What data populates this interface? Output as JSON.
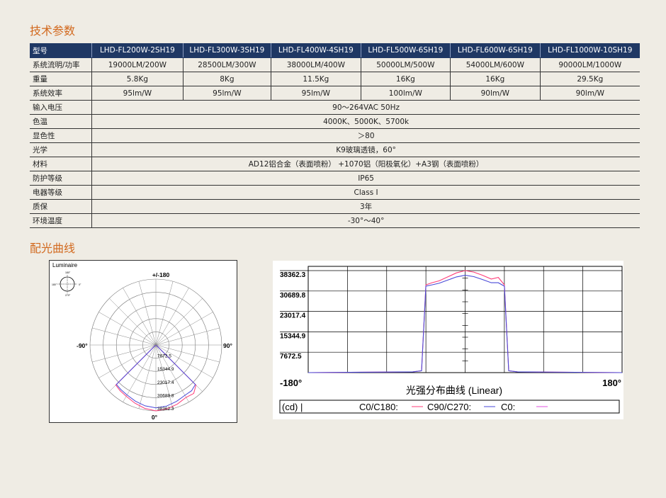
{
  "sections": {
    "spec_title": "技术参数",
    "curve_title": "配光曲线"
  },
  "spec_table": {
    "header": [
      "型号",
      "LHD-FL200W-2SH19",
      "LHD-FL300W-3SH19",
      "LHD-FL400W-4SH19",
      "LHD-FL500W-6SH19",
      "LHD-FL600W-6SH19",
      "LHD-FL1000W-10SH19"
    ],
    "rows": [
      {
        "label": "系统流明/功率",
        "cells": [
          "19000LM/200W",
          "28500LM/300W",
          "38000LM/400W",
          "50000LM/500W",
          "54000LM/600W",
          "90000LM/1000W"
        ]
      },
      {
        "label": "重量",
        "cells": [
          "5.8Kg",
          "8Kg",
          "11.5Kg",
          "16Kg",
          "16Kg",
          "29.5Kg"
        ]
      },
      {
        "label": "系统效率",
        "cells": [
          "95lm/W",
          "95lm/W",
          "95lm/W",
          "100lm/W",
          "90lm/W",
          "90lm/W"
        ]
      },
      {
        "label": "输入电压",
        "span": "90～264VAC   50Hz"
      },
      {
        "label": "色温",
        "span": "4000K、5000K、5700k"
      },
      {
        "label": "显色性",
        "span": "＞80"
      },
      {
        "label": "光学",
        "span": "K9玻璃透镜，60°"
      },
      {
        "label": "材料",
        "span": "AD12铝合金（表面喷粉） +1070铝（阳极氧化）+A3钢（表面喷粉）"
      },
      {
        "label": "防护等级",
        "span": "IP65"
      },
      {
        "label": "电器等级",
        "span": "Class  I"
      },
      {
        "label": "质保",
        "span": "3年"
      },
      {
        "label": "环境温度",
        "span": "-30°～40°"
      }
    ]
  },
  "polar_chart": {
    "luminaire_label": "Luminaire",
    "top_label": "+/-180",
    "left_label": "-90°",
    "right_label": "90°",
    "bottom_label": "0°",
    "ring_labels": [
      "7672.5",
      "15344.9",
      "23017.4",
      "30689.8",
      "38362.3"
    ]
  },
  "chart_data": {
    "type": "line",
    "title": "光强分布曲线 (Linear)",
    "x_min_label": "-180°",
    "x_max_label": "180°",
    "ylim": [
      0,
      38362.3
    ],
    "y_ticks": [
      "38362.3",
      "30689.8",
      "23017.4",
      "15344.9",
      "7672.5"
    ],
    "x": [
      -180,
      -60,
      -50,
      -45,
      -38,
      -30,
      -20,
      -10,
      0,
      10,
      20,
      30,
      38,
      45,
      50,
      60,
      180
    ],
    "series": [
      {
        "name": "C0/C180:",
        "color": "#ff3c78",
        "values": [
          0,
          300,
          700,
          33000,
          33800,
          34500,
          36000,
          37500,
          38362,
          37800,
          36600,
          35200,
          35800,
          33000,
          700,
          300,
          0
        ]
      },
      {
        "name": "C90/C270:",
        "color": "#4a4ad8",
        "values": [
          0,
          300,
          700,
          32500,
          33000,
          33600,
          34800,
          36000,
          36600,
          36100,
          35000,
          33800,
          33800,
          32500,
          700,
          300,
          0
        ]
      },
      {
        "name": "C0:",
        "color": "#e050e0",
        "values": []
      }
    ],
    "legend_prefix": "(cd) |"
  },
  "colors": {
    "header_bg": "#1f3864",
    "section_title": "#d2691e",
    "page_bg": "#efece4"
  }
}
